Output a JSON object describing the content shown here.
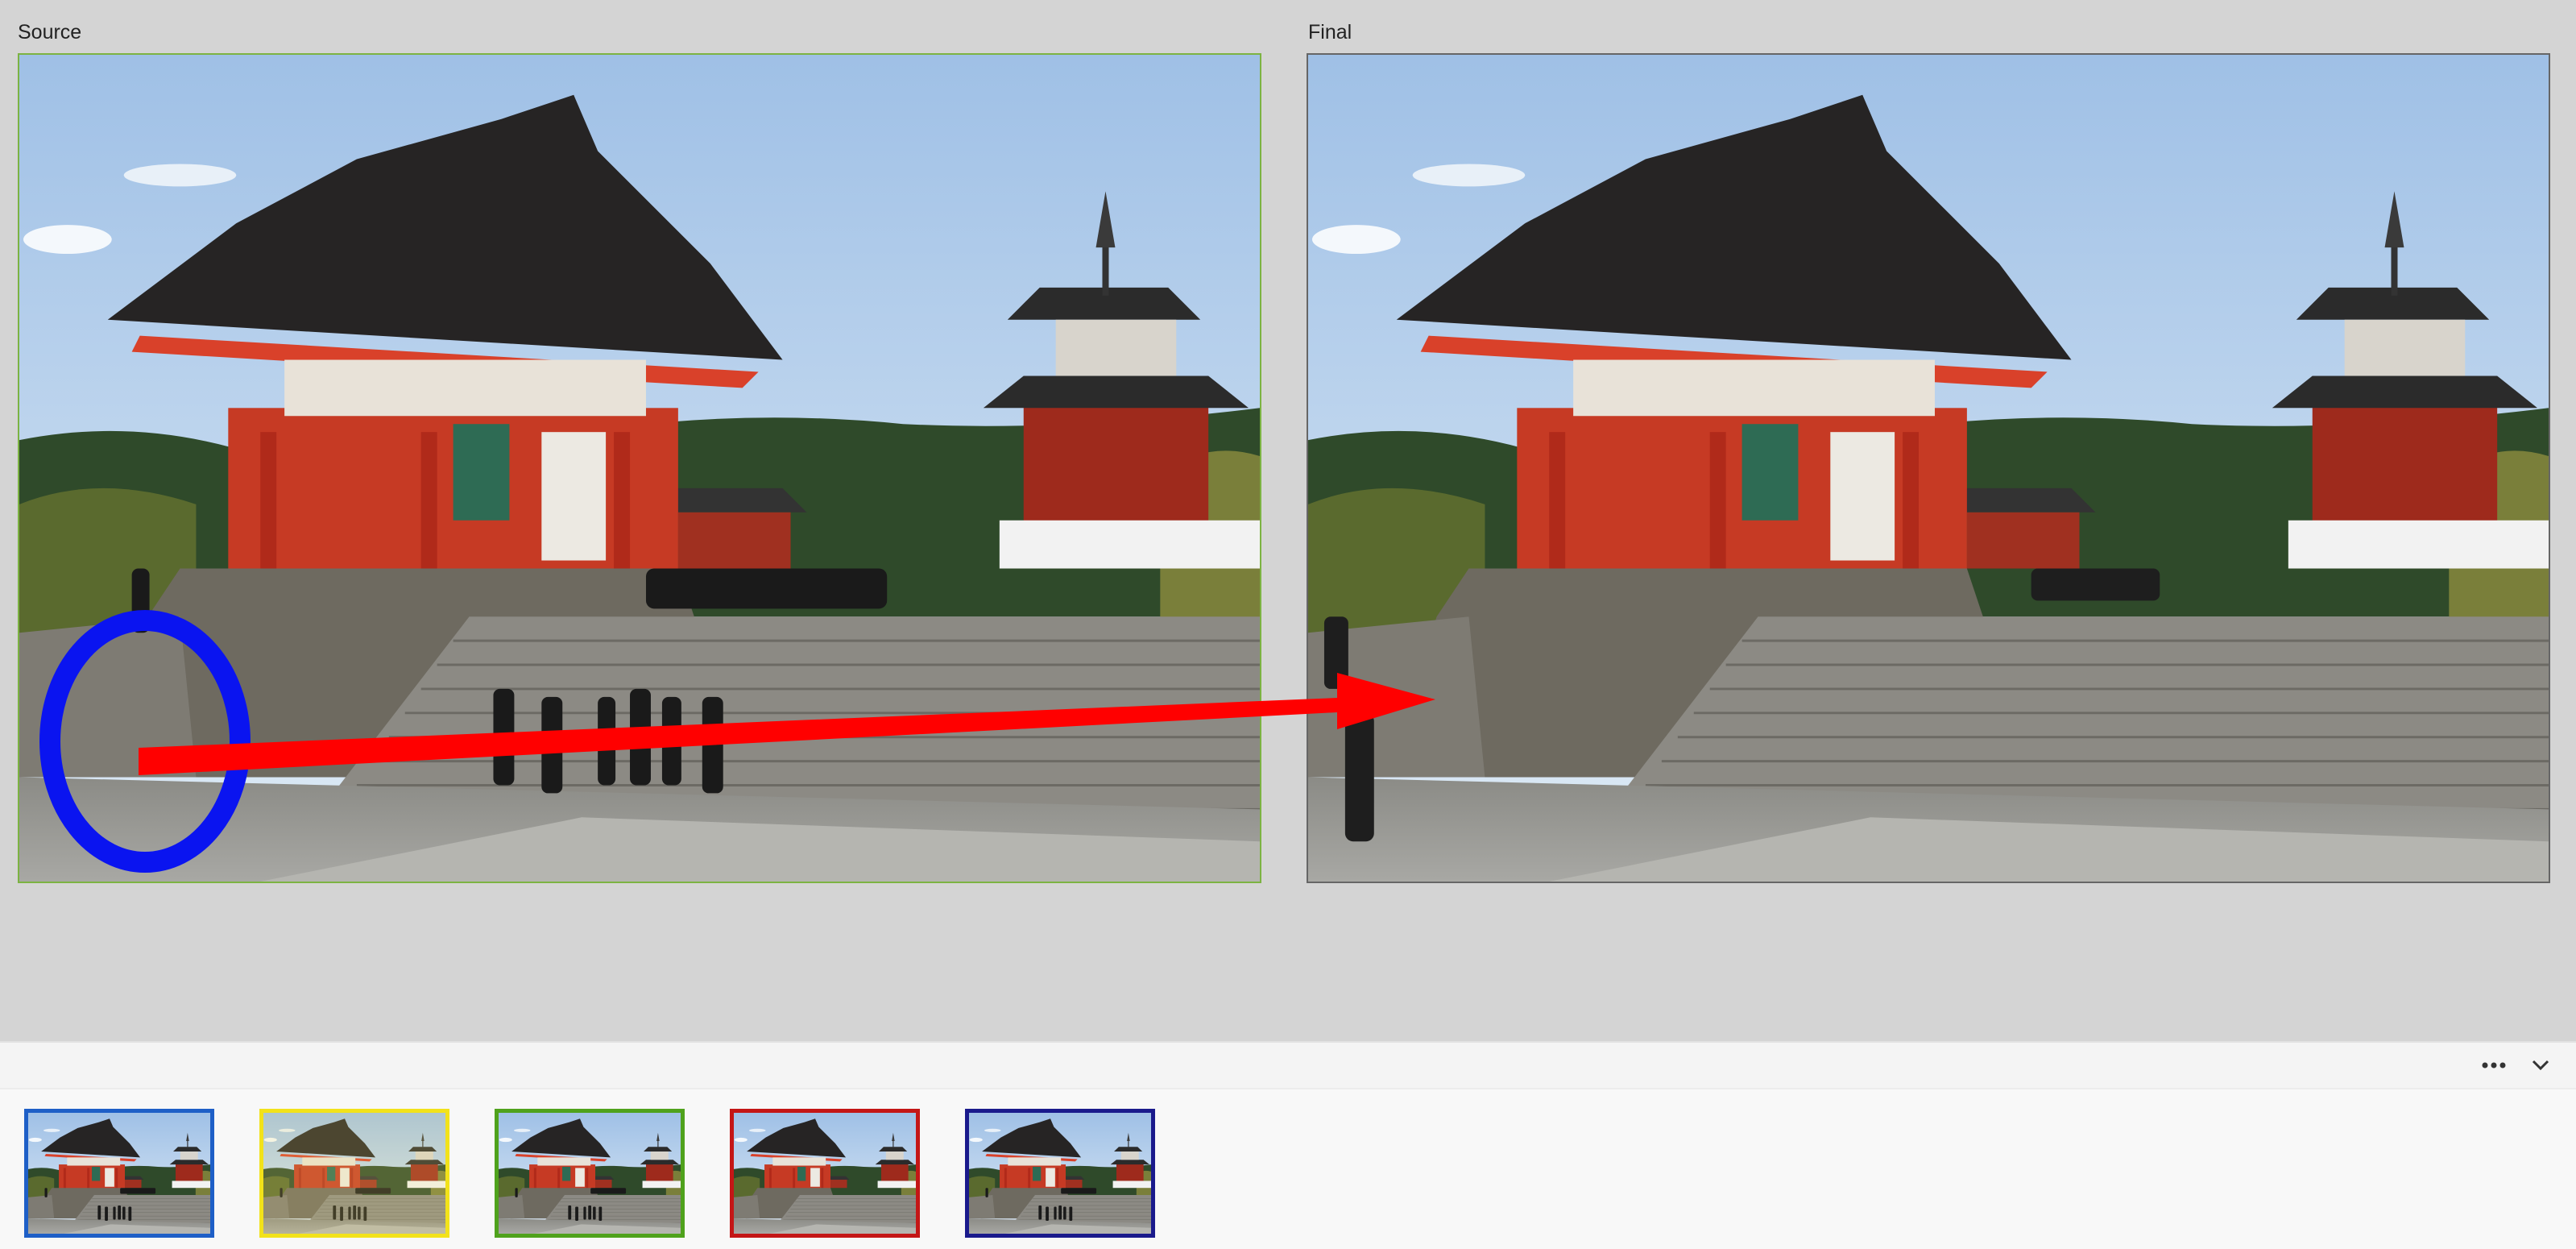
{
  "panes": {
    "source_label": "Source",
    "final_label": "Final"
  },
  "annotations": {
    "circle_color": "#0a14f0",
    "arrow_color": "#ff0000"
  },
  "strip": {
    "more_icon": "more-horizontal-icon",
    "collapse_icon": "chevron-down-icon",
    "thumbnails": [
      {
        "name": "thumbnail-1",
        "border": "#1e5fc7"
      },
      {
        "name": "thumbnail-2",
        "border": "#f2e21a"
      },
      {
        "name": "thumbnail-3",
        "border": "#4fa21c"
      },
      {
        "name": "thumbnail-4",
        "border": "#c41616"
      },
      {
        "name": "thumbnail-5",
        "border": "#1a1a8c"
      }
    ]
  }
}
